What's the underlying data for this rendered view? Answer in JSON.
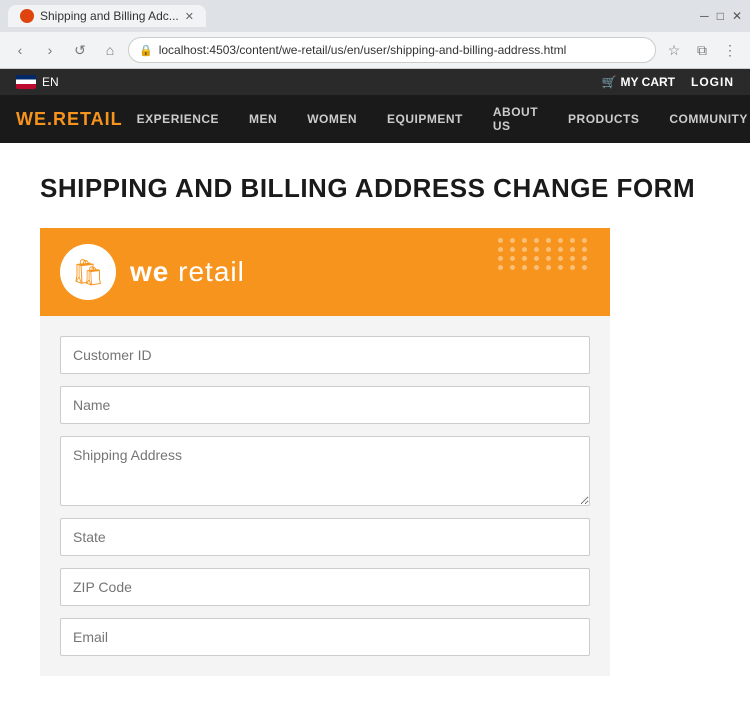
{
  "browser": {
    "tab_title": "Shipping and Billing Adc...",
    "url": "localhost:4503/content/we-retail/us/en/user/shipping-and-billing-address.html",
    "favicon_color": "#e0440e"
  },
  "lang_bar": {
    "flag_label": "EN",
    "cart_label": "MY CART",
    "login_label": "LOGIN"
  },
  "nav": {
    "brand": "WE.",
    "brand_accent": "RETAIL",
    "links": [
      "EXPERIENCE",
      "MEN",
      "WOMEN",
      "EQUIPMENT",
      "ABOUT US",
      "PRODUCTS",
      "COMMUNITY"
    ]
  },
  "page": {
    "title": "SHIPPING AND BILLING ADDRESS CHANGE FORM"
  },
  "form_header": {
    "brand_first": "we",
    "brand_second": " retail"
  },
  "form": {
    "customer_id_placeholder": "Customer ID",
    "name_placeholder": "Name",
    "shipping_address_placeholder": "Shipping Address",
    "state_placeholder": "State",
    "zip_placeholder": "ZIP Code",
    "email_placeholder": "Email"
  },
  "icons": {
    "back": "‹",
    "forward": "›",
    "reload": "↺",
    "home": "⌂",
    "star": "☆",
    "menu": "⋮",
    "search": "🔍",
    "cart": "🛒",
    "bag": "🛍"
  }
}
